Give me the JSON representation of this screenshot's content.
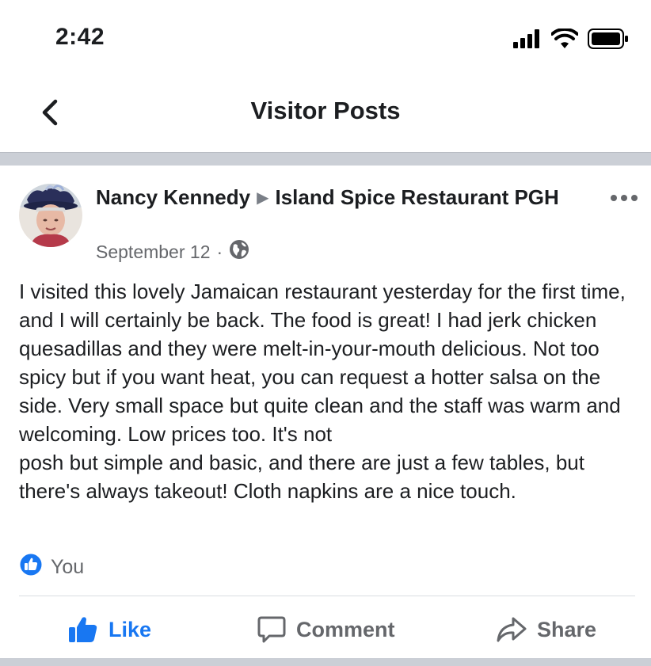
{
  "status_bar": {
    "time": "2:42"
  },
  "nav": {
    "title": "Visitor Posts"
  },
  "post": {
    "author": "Nancy Kennedy",
    "target_page": "Island Spice Restaurant PGH",
    "date": "September 12",
    "separator": "·",
    "privacy_icon": "globe-icon",
    "body": "I visited this lovely Jamaican restaurant yesterday for the first time, and I will certainly be back. The food is great! I had jerk chicken quesadillas and they were melt-in-your-mouth delicious. Not too spicy but if you want heat, you can request a hotter salsa on the side. Very small space but quite clean and the staff was warm and welcoming. Low prices too. It's not\nposh but simple and basic, and there are just a few tables, but there's always takeout! Cloth napkins are a nice touch.",
    "reactions_text": "You"
  },
  "actions": {
    "like": "Like",
    "comment": "Comment",
    "share": "Share"
  },
  "colors": {
    "accent": "#1877f2",
    "secondary_text": "#65676b",
    "separator": "#cbcfd6"
  }
}
